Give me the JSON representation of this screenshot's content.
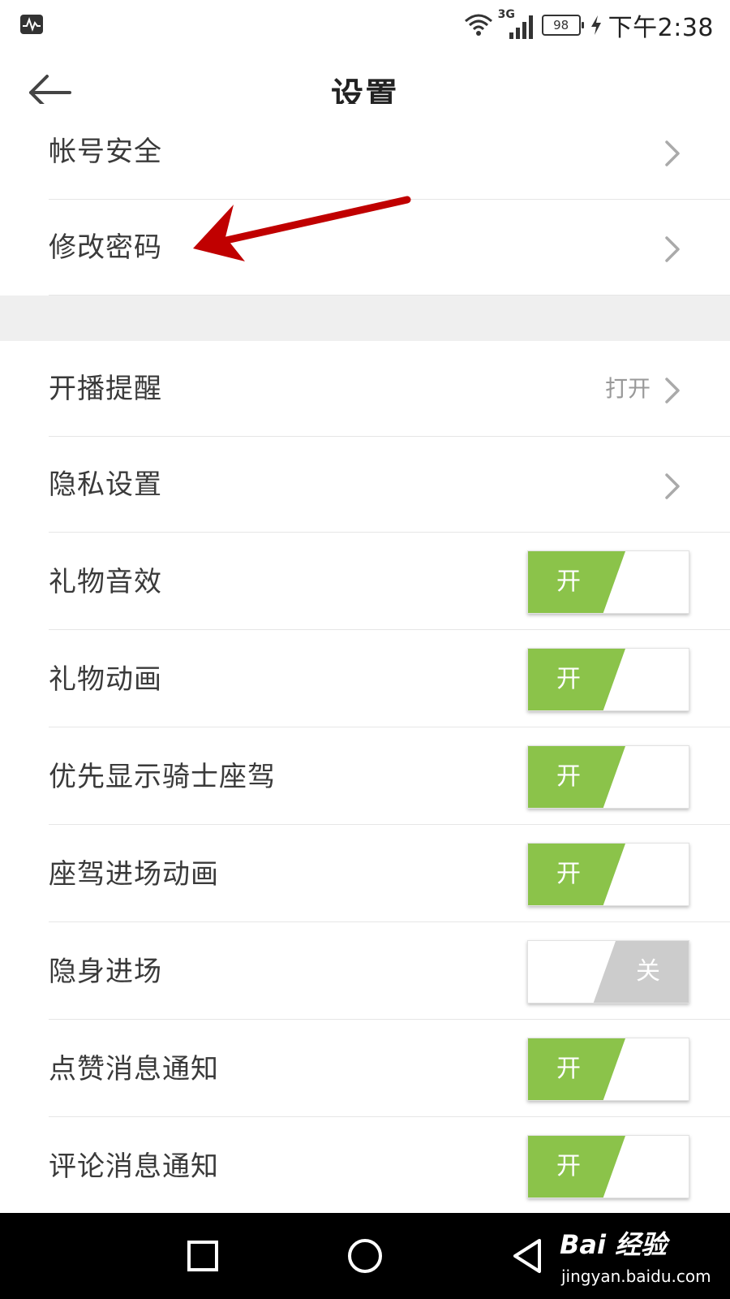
{
  "status_bar": {
    "left_icon": "pulse-notification-icon",
    "network_label": "3G",
    "battery": "98",
    "time": "下午2:38"
  },
  "header": {
    "title": "设置",
    "back_icon": "arrow-left-icon"
  },
  "section_account": {
    "items": [
      {
        "label": "帐号安全",
        "icon": "chevron-right-icon"
      },
      {
        "label": "修改密码",
        "icon": "chevron-right-icon"
      }
    ]
  },
  "section_settings": {
    "broadcast_reminder": {
      "label": "开播提醒",
      "value": "打开",
      "icon": "chevron-right-icon"
    },
    "privacy_settings": {
      "label": "隐私设置",
      "icon": "chevron-right-icon"
    },
    "toggles": [
      {
        "label": "礼物音效",
        "state_text": "开",
        "on": true
      },
      {
        "label": "礼物动画",
        "state_text": "开",
        "on": true
      },
      {
        "label": "优先显示骑士座驾",
        "state_text": "开",
        "on": true
      },
      {
        "label": "座驾进场动画",
        "state_text": "开",
        "on": true
      },
      {
        "label": "隐身进场",
        "state_text": "关",
        "on": false
      },
      {
        "label": "点赞消息通知",
        "state_text": "开",
        "on": true
      },
      {
        "label": "评论消息通知",
        "state_text": "开",
        "on": true
      }
    ]
  },
  "nav_bar": {
    "recent_icon": "square-recent-apps-icon",
    "home_icon": "circle-home-icon",
    "back_icon": "triangle-back-icon"
  },
  "watermark": {
    "logo_text": "Bai 经验",
    "url": "jingyan.baidu.com"
  },
  "colors": {
    "toggle_on": "#8bc34a",
    "toggle_off": "#cccccc",
    "annotation_arrow": "#c00000",
    "divider": "#e6e6e6",
    "section_gap": "#efefef"
  }
}
